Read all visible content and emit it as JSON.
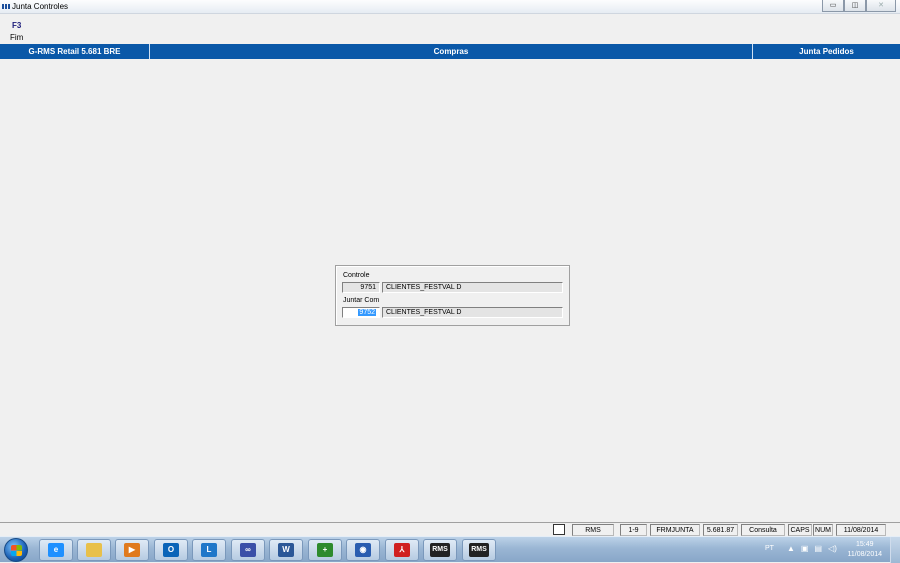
{
  "window": {
    "title": "Junta Controles"
  },
  "window_buttons": {
    "minimize": "▭",
    "maximize": "◫",
    "close": "✕"
  },
  "toolbar": {
    "key": "F3",
    "label": "Fim"
  },
  "header": {
    "left": "G-RMS Retail 5.681 BRE",
    "center": "Compras",
    "right": "Junta Pedidos"
  },
  "form": {
    "controle": {
      "label": "Controle",
      "code": "9751",
      "description": "CLIENTES_FESTVAL D"
    },
    "juntar_com": {
      "label": "Juntar Com",
      "code": "9752",
      "description": "CLIENTES_FESTVAL D"
    }
  },
  "status": {
    "cells": [
      "RMS",
      "1-9",
      "FRMJUNTA",
      "5.681.87",
      "Consulta",
      "CAPS",
      "NUM",
      "11/08/2014"
    ]
  },
  "taskbar": {
    "apps": [
      {
        "name": "internet-explorer-icon",
        "text": "e",
        "color": "#1e90ff"
      },
      {
        "name": "explorer-folder-icon",
        "text": "",
        "color": "#e8c04a"
      },
      {
        "name": "media-player-icon",
        "text": "▶",
        "color": "#e07a1e"
      },
      {
        "name": "outlook-icon",
        "text": "O",
        "color": "#0a64b8"
      },
      {
        "name": "lync-icon",
        "text": "L",
        "color": "#1f77c9"
      },
      {
        "name": "infinity-app-icon",
        "text": "∞",
        "color": "#3a4fa8"
      },
      {
        "name": "word-icon",
        "text": "W",
        "color": "#2b5797"
      },
      {
        "name": "installer-icon",
        "text": "+",
        "color": "#2e8b2e"
      },
      {
        "name": "app-icon",
        "text": "◉",
        "color": "#2a5db0"
      },
      {
        "name": "acrobat-icon",
        "text": "⅄",
        "color": "#d02020"
      },
      {
        "name": "rms-app-icon-1",
        "text": "RMS",
        "color": "#222"
      },
      {
        "name": "rms-app-icon-2",
        "text": "RMS",
        "color": "#222"
      }
    ],
    "lang": "PT",
    "time": "15:49",
    "date": "11/08/2014"
  }
}
